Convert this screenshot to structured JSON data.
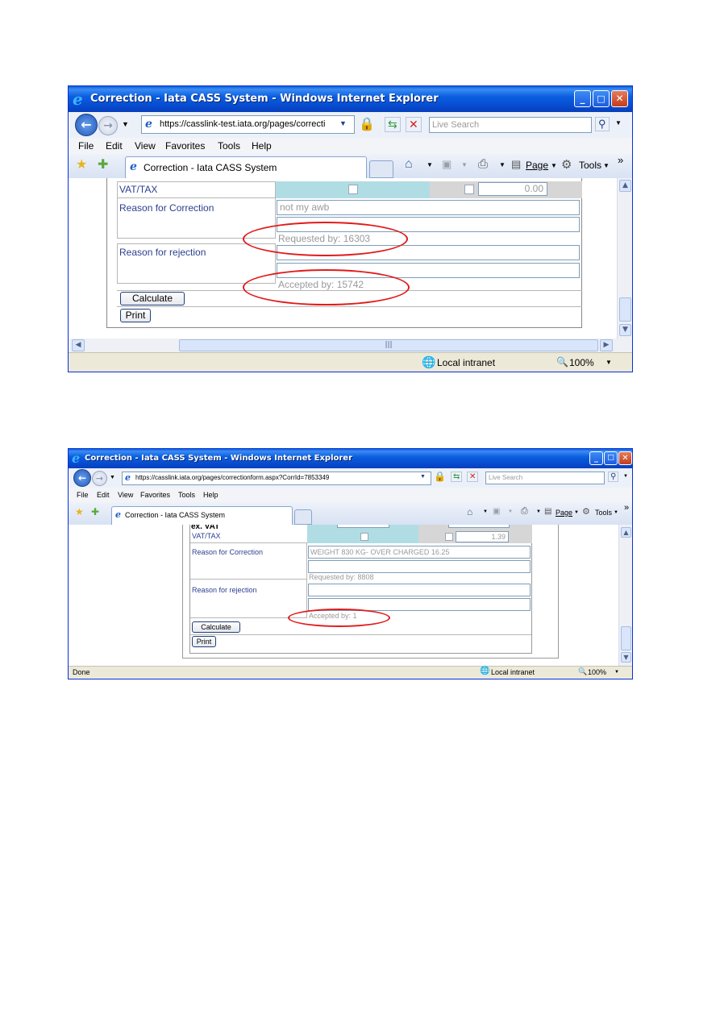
{
  "screenshot1": {
    "window_title": "Correction - Iata CASS System - Windows Internet Explorer",
    "address_url": "https://casslink-test.iata.org/pages/correcti",
    "search_placeholder": "Live Search",
    "menu": [
      "File",
      "Edit",
      "View",
      "Favorites",
      "Tools",
      "Help"
    ],
    "tab_label": "Correction - Iata CASS System",
    "toolbar": {
      "page_label": "Page",
      "tools_label": "Tools",
      "chevron": "»"
    },
    "form": {
      "vat_label": "VAT/TAX",
      "vat_value": "0.00",
      "reason_correction_label": "Reason for Correction",
      "reason_correction_value": "not my awb",
      "requested_by": "Requested by: 16303",
      "reason_rejection_label": "Reason for rejection",
      "accepted_by": "Accepted by: 15742",
      "calculate_label": "Calculate",
      "print_label": "Print"
    },
    "status": {
      "zone": "Local intranet",
      "zoom": "100%"
    },
    "colors": {
      "highlight_cell": "#b0dde4",
      "gray_cell": "#d6d6d6",
      "annotation": "#e01b1b"
    }
  },
  "screenshot2": {
    "window_title": "Correction - Iata CASS System - Windows Internet Explorer",
    "address_url": "https://casslink.iata.org/pages/correctionform.aspx?CorrId=7853349",
    "search_placeholder": "Live Search",
    "menu": [
      "File",
      "Edit",
      "View",
      "Favorites",
      "Tools",
      "Help"
    ],
    "tab_label": "Correction - Iata CASS System",
    "toolbar": {
      "page_label": "Page",
      "tools_label": "Tools",
      "chevron": "»"
    },
    "form": {
      "ex_vat_label": "ex. VAT",
      "vat_label": "VAT/TAX",
      "vat_value": "1.39",
      "reason_correction_label": "Reason for Correction",
      "reason_correction_value": "WEIGHT 830 KG- OVER CHARGED 16.25",
      "requested_by": "Requested by: 8808",
      "reason_rejection_label": "Reason for rejection",
      "accepted_by": "Accepted by: 1",
      "calculate_label": "Calculate",
      "print_label": "Print"
    },
    "status": {
      "left": "Done",
      "zone": "Local intranet",
      "zoom": "100%"
    }
  }
}
